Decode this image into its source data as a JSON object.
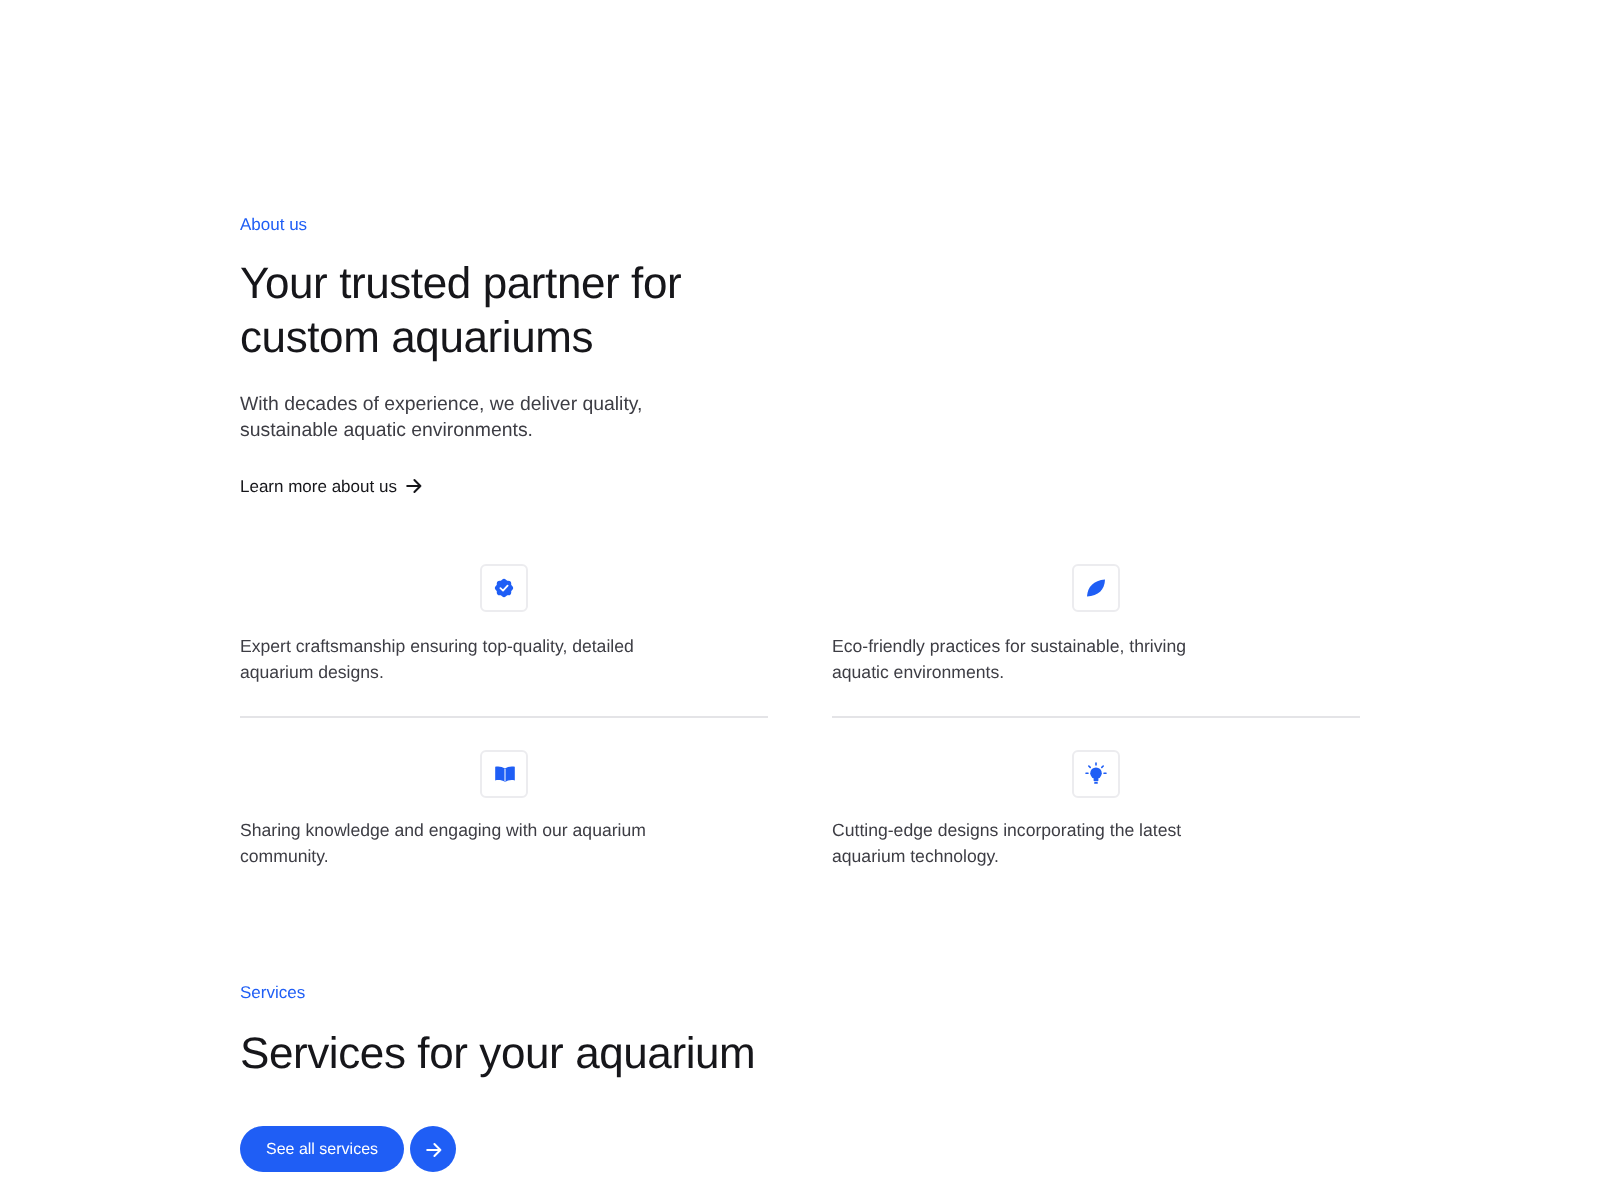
{
  "about": {
    "eyebrow": "About us",
    "heading": "Your trusted partner for custom aquariums",
    "description": "With decades of experience, we deliver quality, sustainable aquatic environments.",
    "link": "Learn more about us"
  },
  "features": [
    {
      "kind": "badge",
      "text": "Expert craftsmanship ensuring top-quality, detailed aquarium designs."
    },
    {
      "kind": "leaf",
      "text": "Eco-friendly practices for sustainable, thriving aquatic environments."
    },
    {
      "kind": "book",
      "text": "Sharing knowledge and engaging with our aquarium community."
    },
    {
      "kind": "bulb",
      "text": "Cutting-edge designs incorporating the latest aquarium technology."
    }
  ],
  "services": {
    "eyebrow": "Services",
    "heading": "Services for your aquarium",
    "button": "See all services"
  }
}
